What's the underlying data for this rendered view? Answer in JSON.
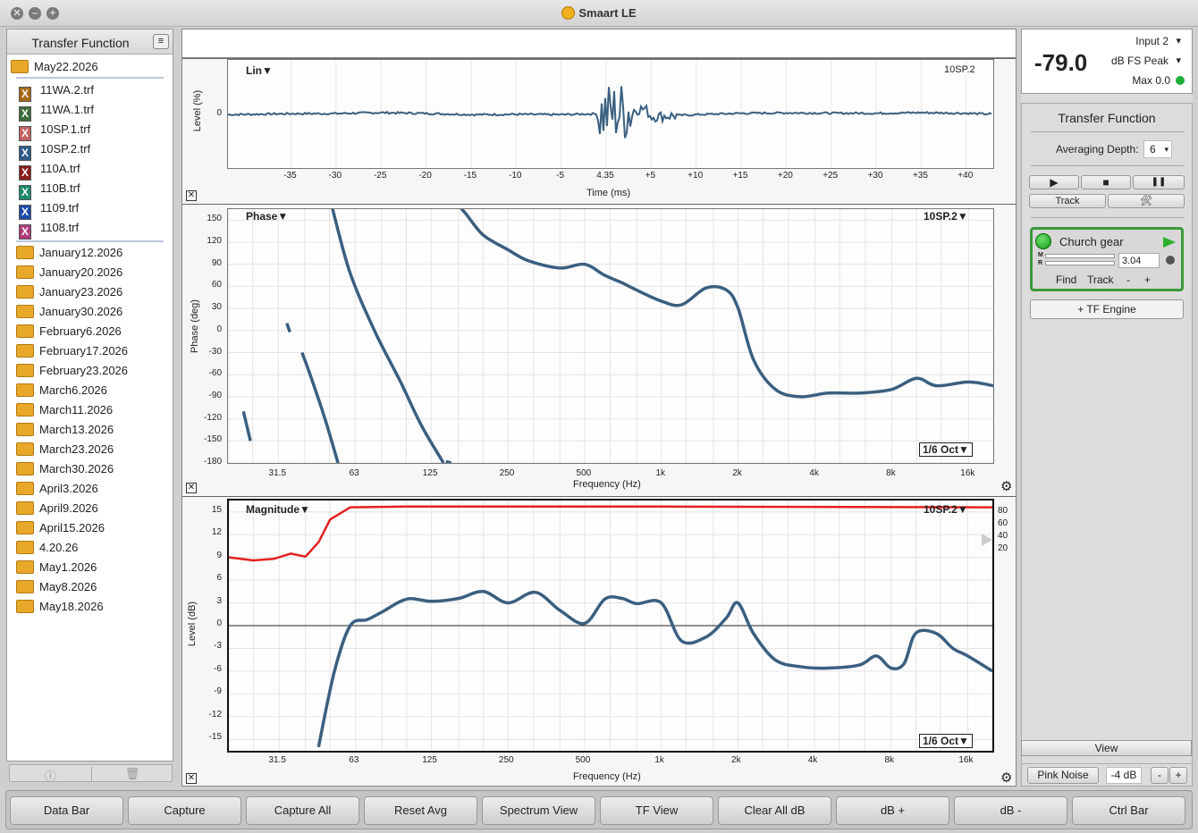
{
  "window": {
    "title": "Smaart LE"
  },
  "left_panel": {
    "title": "Transfer Function",
    "current_folder": "May22.2026",
    "files": [
      {
        "label": "11WA.2.trf",
        "color": "#a86a14"
      },
      {
        "label": "11WA.1.trf",
        "color": "#3c6a3a"
      },
      {
        "label": "10SP.1.trf",
        "color": "#c46060"
      },
      {
        "label": "10SP.2.trf",
        "color": "#2f5a8a"
      },
      {
        "label": "110A.trf",
        "color": "#8a1c1c"
      },
      {
        "label": "110B.trf",
        "color": "#1c8a6a"
      },
      {
        "label": "1109.trf",
        "color": "#1c4aa8"
      },
      {
        "label": "1108.trf",
        "color": "#b03a7a"
      }
    ],
    "folders": [
      "January12.2026",
      "January20.2026",
      "January23.2026",
      "January30.2026",
      "February6.2026",
      "February17.2026",
      "February23.2026",
      "March6.2026",
      "March11.2026",
      "March13.2026",
      "March23.2026",
      "March30.2026",
      "April3.2026",
      "April9.2026",
      "April15.2026",
      "4.20.26",
      "May1.2026",
      "May8.2026",
      "May18.2026"
    ],
    "footer": {
      "info_icon": "info-icon",
      "trash_icon": "trash-icon"
    }
  },
  "impulse": {
    "mode_label": "Lin▼",
    "trace_label": "10SP.2",
    "y_label": "Level (%)",
    "y_ticks": [
      "0"
    ],
    "x_label": "Time (ms)",
    "x_ticks": [
      "-35",
      "-30",
      "-25",
      "-20",
      "-15",
      "-10",
      "-5",
      "4.35",
      "+5",
      "+10",
      "+15",
      "+20",
      "+25",
      "+30",
      "+35",
      "+40"
    ]
  },
  "phase": {
    "mode_label": "Phase▼",
    "trace_label": "10SP.2▼",
    "y_label": "Phase (deg)",
    "y_ticks": [
      "150",
      "120",
      "90",
      "60",
      "30",
      "0",
      "-30",
      "-60",
      "-90",
      "-120",
      "-150",
      "-180"
    ],
    "x_label": "Frequency (Hz)",
    "x_ticks": [
      "31.5",
      "63",
      "125",
      "250",
      "500",
      "1k",
      "2k",
      "4k",
      "8k",
      "16k"
    ],
    "smoothing": "1/6 Oct▼"
  },
  "magnitude": {
    "mode_label": "Magnitude▼",
    "trace_label": "10SP.2▼",
    "y_label": "Level (dB)",
    "y_ticks": [
      "15",
      "12",
      "9",
      "6",
      "3",
      "0",
      "-3",
      "-6",
      "-9",
      "-12",
      "-15"
    ],
    "coherence_ticks": [
      "80",
      "60",
      "40",
      "20"
    ],
    "x_label": "Frequency (Hz)",
    "x_ticks": [
      "31.5",
      "63",
      "125",
      "250",
      "500",
      "1k",
      "2k",
      "4k",
      "8k",
      "16k"
    ],
    "smoothing": "1/6 Oct▼"
  },
  "meter": {
    "value": "-79.0",
    "input": "Input 2",
    "mode": "dB FS Peak",
    "max": "Max 0.0",
    "dropdown_glyph": "▾"
  },
  "tf_panel": {
    "title": "Transfer Function",
    "avg_label": "Averaging Depth:",
    "avg_value": "6",
    "play": "▶",
    "stop": "■",
    "pause": "❚❚",
    "track": "Track",
    "tools": "🛠",
    "engine_name": "Church gear",
    "delay_value": "3.04",
    "m_label": "M",
    "r_label": "R",
    "find": "Find",
    "track2": "Track",
    "minus": "-",
    "plus": "+",
    "add_engine": "+ TF Engine"
  },
  "view_panel": {
    "label": "View",
    "generator": "Pink Noise",
    "gen_level": "-4 dB",
    "minus": "-",
    "plus": "+"
  },
  "bottom_buttons": [
    "Data Bar",
    "Capture",
    "Capture All",
    "Reset Avg",
    "Spectrum View",
    "TF View",
    "Clear All dB",
    "dB +",
    "dB -",
    "Ctrl Bar"
  ],
  "colors": {
    "trace": "#3a5f80",
    "coherence": "#e52020",
    "engine_border": "#3a9a3a"
  },
  "chart_data": [
    {
      "type": "line",
      "title": "Lin",
      "xlabel": "Time (ms)",
      "ylabel": "Level (%)",
      "xlim": [
        -40,
        42
      ],
      "series": [
        {
          "name": "10SP.2",
          "x": [
            -42,
            -35,
            -30,
            -25,
            -20,
            -15,
            -10,
            -5,
            0,
            4.35,
            5,
            10,
            15,
            20,
            25,
            30,
            35,
            40,
            42
          ],
          "y": [
            -0.05,
            0.02,
            0.03,
            0.1,
            0.04,
            -0.05,
            -0.03,
            -0.05,
            0.03,
            0.4,
            -0.2,
            -0.05,
            0.05,
            0.08,
            0.06,
            0.05,
            0.1,
            0.05,
            0
          ]
        }
      ]
    },
    {
      "type": "line",
      "title": "Phase",
      "xlabel": "Frequency (Hz)",
      "ylabel": "Phase (deg)",
      "ylim": [
        -180,
        180
      ],
      "series": [
        {
          "name": "10SP.2",
          "x": [
            150,
            170,
            200,
            250,
            300,
            400,
            500,
            600,
            700,
            800,
            1000,
            1200,
            1500,
            1800,
            2000,
            2300,
            2800,
            3500,
            4500,
            6000,
            8000,
            10000,
            12000,
            16000,
            20000
          ],
          "y": [
            180,
            160,
            130,
            110,
            95,
            85,
            90,
            75,
            65,
            55,
            40,
            35,
            58,
            55,
            30,
            -40,
            -80,
            -90,
            -85,
            -85,
            -80,
            -65,
            -75,
            -70,
            -75
          ]
        }
      ]
    },
    {
      "type": "line",
      "title": "Magnitude",
      "xlabel": "Frequency (Hz)",
      "ylabel": "Level (dB)",
      "ylim": [
        -15,
        15
      ],
      "series": [
        {
          "name": "10SP.2",
          "x": [
            45,
            52,
            60,
            70,
            80,
            100,
            125,
            160,
            200,
            250,
            320,
            400,
            500,
            600,
            700,
            800,
            1000,
            1200,
            1500,
            1800,
            2000,
            2300,
            2800,
            3500,
            4500,
            6000,
            7000,
            8000,
            9000,
            10000,
            12000,
            14000,
            16000,
            20000
          ],
          "y": [
            -16,
            -6,
            0,
            0.8,
            1.8,
            3.5,
            3.2,
            3.6,
            4.5,
            3,
            4.4,
            2,
            0.3,
            3.5,
            3.6,
            2.9,
            3,
            -2,
            -1.5,
            1,
            3,
            -1,
            -4.5,
            -5.4,
            -5.6,
            -5.2,
            -4,
            -5.6,
            -5,
            -1,
            -1,
            -3,
            -4,
            -6
          ]
        },
        {
          "name": "Coherence",
          "x": [
            20,
            25,
            30,
            35,
            40,
            45,
            50,
            60,
            100,
            1000,
            20000
          ],
          "y": [
            9,
            8.6,
            8.8,
            9.5,
            9.1,
            11,
            14,
            15.6,
            15.7,
            15.7,
            15.6
          ]
        }
      ]
    }
  ]
}
